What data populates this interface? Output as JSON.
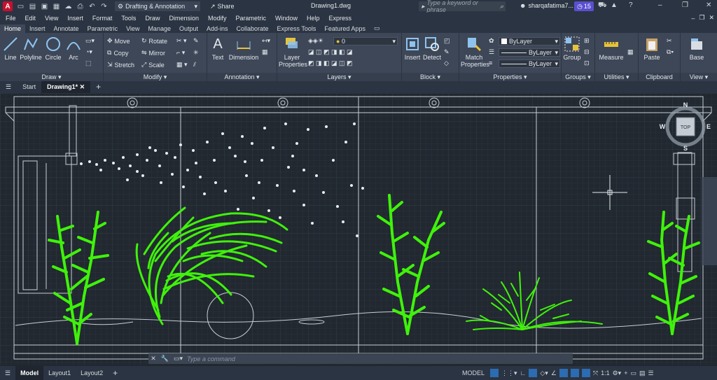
{
  "app": {
    "logo_letter": "A",
    "workspace": "Drafting & Annotation",
    "share_label": "Share",
    "document_title": "Drawing1.dwg",
    "search_placeholder": "Type a keyword or phrase",
    "user_name": "sharqafatima7...",
    "badge_count": "15"
  },
  "menu": [
    "File",
    "Edit",
    "View",
    "Insert",
    "Format",
    "Tools",
    "Draw",
    "Dimension",
    "Modify",
    "Parametric",
    "Window",
    "Help",
    "Express"
  ],
  "ribbon_tabs": [
    {
      "label": "Home",
      "active": true
    },
    {
      "label": "Insert"
    },
    {
      "label": "Annotate"
    },
    {
      "label": "Parametric"
    },
    {
      "label": "View"
    },
    {
      "label": "Manage"
    },
    {
      "label": "Output"
    },
    {
      "label": "Add-ins"
    },
    {
      "label": "Collaborate"
    },
    {
      "label": "Express Tools"
    },
    {
      "label": "Featured Apps"
    }
  ],
  "panels": {
    "draw": {
      "title": "Draw",
      "line": "Line",
      "polyline": "Polyline",
      "circle": "Circle",
      "arc": "Arc"
    },
    "modify": {
      "title": "Modify",
      "move": "Move",
      "rotate": "Rotate",
      "copy": "Copy",
      "mirror": "Mirror",
      "stretch": "Stretch",
      "scale": "Scale"
    },
    "annotation": {
      "title": "Annotation",
      "text": "Text",
      "dimension": "Dimension"
    },
    "layers": {
      "title": "Layers",
      "layer_properties": "Layer Properties",
      "current_layer": "0"
    },
    "block": {
      "title": "Block",
      "insert": "Insert",
      "detect": "Detect"
    },
    "properties": {
      "title": "Properties",
      "match": "Match Properties",
      "color": "ByLayer",
      "linetype": "ByLayer",
      "lineweight": "ByLayer"
    },
    "groups": {
      "title": "Groups",
      "group": "Group"
    },
    "utilities": {
      "title": "Utilities",
      "measure": "Measure"
    },
    "clipboard": {
      "title": "Clipboard",
      "paste": "Paste"
    },
    "view": {
      "title": "View",
      "base": "Base"
    }
  },
  "doc_tabs": {
    "start": "Start",
    "drawing": "Drawing1*"
  },
  "viewcube": {
    "n": "N",
    "s": "S",
    "e": "E",
    "w": "W",
    "face": "TOP"
  },
  "command": {
    "placeholder": "Type a command"
  },
  "layout_tabs": [
    {
      "label": "Model",
      "active": true
    },
    {
      "label": "Layout1"
    },
    {
      "label": "Layout2"
    }
  ],
  "status": {
    "model": "MODEL",
    "scale": "1:1"
  },
  "colors": {
    "plant": "#3ff20a",
    "wire": "#c8ced6",
    "bubble": "#e8ecf0",
    "accent": "#2b6cb3"
  }
}
